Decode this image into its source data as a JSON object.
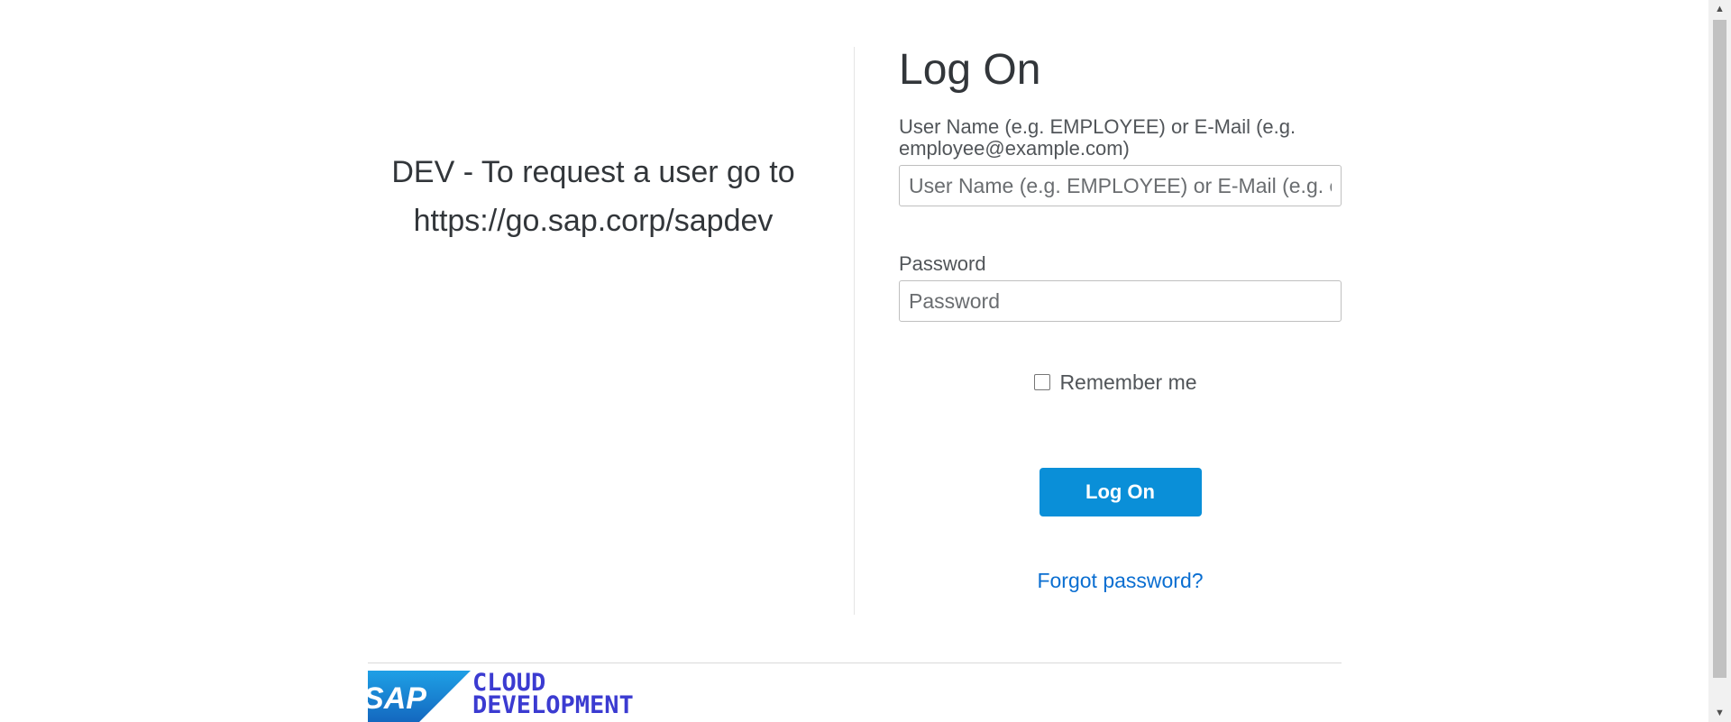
{
  "info": {
    "line1": "DEV - To request a user go to",
    "line2": "https://go.sap.corp/sapdev"
  },
  "form": {
    "title": "Log On",
    "username_label": "User Name (e.g. EMPLOYEE) or E-Mail (e.g. employee@example.com)",
    "username_placeholder": "User Name (e.g. EMPLOYEE) or E-Mail (e.g. employee@example.com)",
    "username_value": "",
    "password_label": "Password",
    "password_placeholder": "Password",
    "password_value": "",
    "remember_label": "Remember me",
    "remember_checked": false,
    "logon_button": "Log On",
    "forgot_link": "Forgot password?"
  },
  "footer": {
    "logo_text": "SAP",
    "brand_line1": "CLOUD",
    "brand_line2": "DEVELOPMENT"
  },
  "colors": {
    "accent": "#0a8fd8",
    "link": "#0a6ed1",
    "brand_text": "#3b3bd1",
    "sap_blue": "#1873c9"
  },
  "scrollbar": {
    "up_icon": "arrow-up-icon",
    "down_icon": "arrow-down-icon"
  }
}
